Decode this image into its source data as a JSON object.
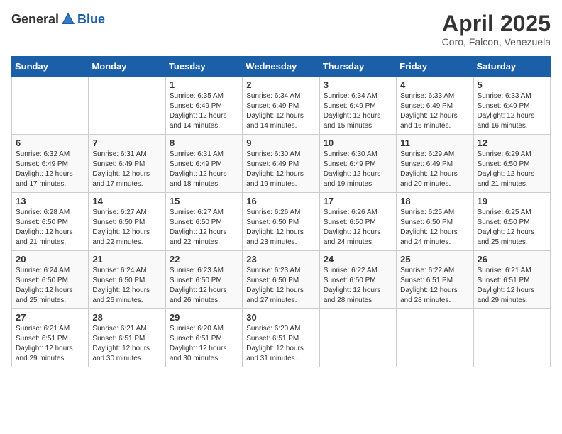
{
  "header": {
    "logo_general": "General",
    "logo_blue": "Blue",
    "title": "April 2025",
    "subtitle": "Coro, Falcon, Venezuela"
  },
  "weekdays": [
    "Sunday",
    "Monday",
    "Tuesday",
    "Wednesday",
    "Thursday",
    "Friday",
    "Saturday"
  ],
  "weeks": [
    [
      {
        "day": "",
        "info": ""
      },
      {
        "day": "",
        "info": ""
      },
      {
        "day": "1",
        "info": "Sunrise: 6:35 AM\nSunset: 6:49 PM\nDaylight: 12 hours and 14 minutes."
      },
      {
        "day": "2",
        "info": "Sunrise: 6:34 AM\nSunset: 6:49 PM\nDaylight: 12 hours and 14 minutes."
      },
      {
        "day": "3",
        "info": "Sunrise: 6:34 AM\nSunset: 6:49 PM\nDaylight: 12 hours and 15 minutes."
      },
      {
        "day": "4",
        "info": "Sunrise: 6:33 AM\nSunset: 6:49 PM\nDaylight: 12 hours and 16 minutes."
      },
      {
        "day": "5",
        "info": "Sunrise: 6:33 AM\nSunset: 6:49 PM\nDaylight: 12 hours and 16 minutes."
      }
    ],
    [
      {
        "day": "6",
        "info": "Sunrise: 6:32 AM\nSunset: 6:49 PM\nDaylight: 12 hours and 17 minutes."
      },
      {
        "day": "7",
        "info": "Sunrise: 6:31 AM\nSunset: 6:49 PM\nDaylight: 12 hours and 17 minutes."
      },
      {
        "day": "8",
        "info": "Sunrise: 6:31 AM\nSunset: 6:49 PM\nDaylight: 12 hours and 18 minutes."
      },
      {
        "day": "9",
        "info": "Sunrise: 6:30 AM\nSunset: 6:49 PM\nDaylight: 12 hours and 19 minutes."
      },
      {
        "day": "10",
        "info": "Sunrise: 6:30 AM\nSunset: 6:49 PM\nDaylight: 12 hours and 19 minutes."
      },
      {
        "day": "11",
        "info": "Sunrise: 6:29 AM\nSunset: 6:49 PM\nDaylight: 12 hours and 20 minutes."
      },
      {
        "day": "12",
        "info": "Sunrise: 6:29 AM\nSunset: 6:50 PM\nDaylight: 12 hours and 21 minutes."
      }
    ],
    [
      {
        "day": "13",
        "info": "Sunrise: 6:28 AM\nSunset: 6:50 PM\nDaylight: 12 hours and 21 minutes."
      },
      {
        "day": "14",
        "info": "Sunrise: 6:27 AM\nSunset: 6:50 PM\nDaylight: 12 hours and 22 minutes."
      },
      {
        "day": "15",
        "info": "Sunrise: 6:27 AM\nSunset: 6:50 PM\nDaylight: 12 hours and 22 minutes."
      },
      {
        "day": "16",
        "info": "Sunrise: 6:26 AM\nSunset: 6:50 PM\nDaylight: 12 hours and 23 minutes."
      },
      {
        "day": "17",
        "info": "Sunrise: 6:26 AM\nSunset: 6:50 PM\nDaylight: 12 hours and 24 minutes."
      },
      {
        "day": "18",
        "info": "Sunrise: 6:25 AM\nSunset: 6:50 PM\nDaylight: 12 hours and 24 minutes."
      },
      {
        "day": "19",
        "info": "Sunrise: 6:25 AM\nSunset: 6:50 PM\nDaylight: 12 hours and 25 minutes."
      }
    ],
    [
      {
        "day": "20",
        "info": "Sunrise: 6:24 AM\nSunset: 6:50 PM\nDaylight: 12 hours and 25 minutes."
      },
      {
        "day": "21",
        "info": "Sunrise: 6:24 AM\nSunset: 6:50 PM\nDaylight: 12 hours and 26 minutes."
      },
      {
        "day": "22",
        "info": "Sunrise: 6:23 AM\nSunset: 6:50 PM\nDaylight: 12 hours and 26 minutes."
      },
      {
        "day": "23",
        "info": "Sunrise: 6:23 AM\nSunset: 6:50 PM\nDaylight: 12 hours and 27 minutes."
      },
      {
        "day": "24",
        "info": "Sunrise: 6:22 AM\nSunset: 6:50 PM\nDaylight: 12 hours and 28 minutes."
      },
      {
        "day": "25",
        "info": "Sunrise: 6:22 AM\nSunset: 6:51 PM\nDaylight: 12 hours and 28 minutes."
      },
      {
        "day": "26",
        "info": "Sunrise: 6:21 AM\nSunset: 6:51 PM\nDaylight: 12 hours and 29 minutes."
      }
    ],
    [
      {
        "day": "27",
        "info": "Sunrise: 6:21 AM\nSunset: 6:51 PM\nDaylight: 12 hours and 29 minutes."
      },
      {
        "day": "28",
        "info": "Sunrise: 6:21 AM\nSunset: 6:51 PM\nDaylight: 12 hours and 30 minutes."
      },
      {
        "day": "29",
        "info": "Sunrise: 6:20 AM\nSunset: 6:51 PM\nDaylight: 12 hours and 30 minutes."
      },
      {
        "day": "30",
        "info": "Sunrise: 6:20 AM\nSunset: 6:51 PM\nDaylight: 12 hours and 31 minutes."
      },
      {
        "day": "",
        "info": ""
      },
      {
        "day": "",
        "info": ""
      },
      {
        "day": "",
        "info": ""
      }
    ]
  ]
}
